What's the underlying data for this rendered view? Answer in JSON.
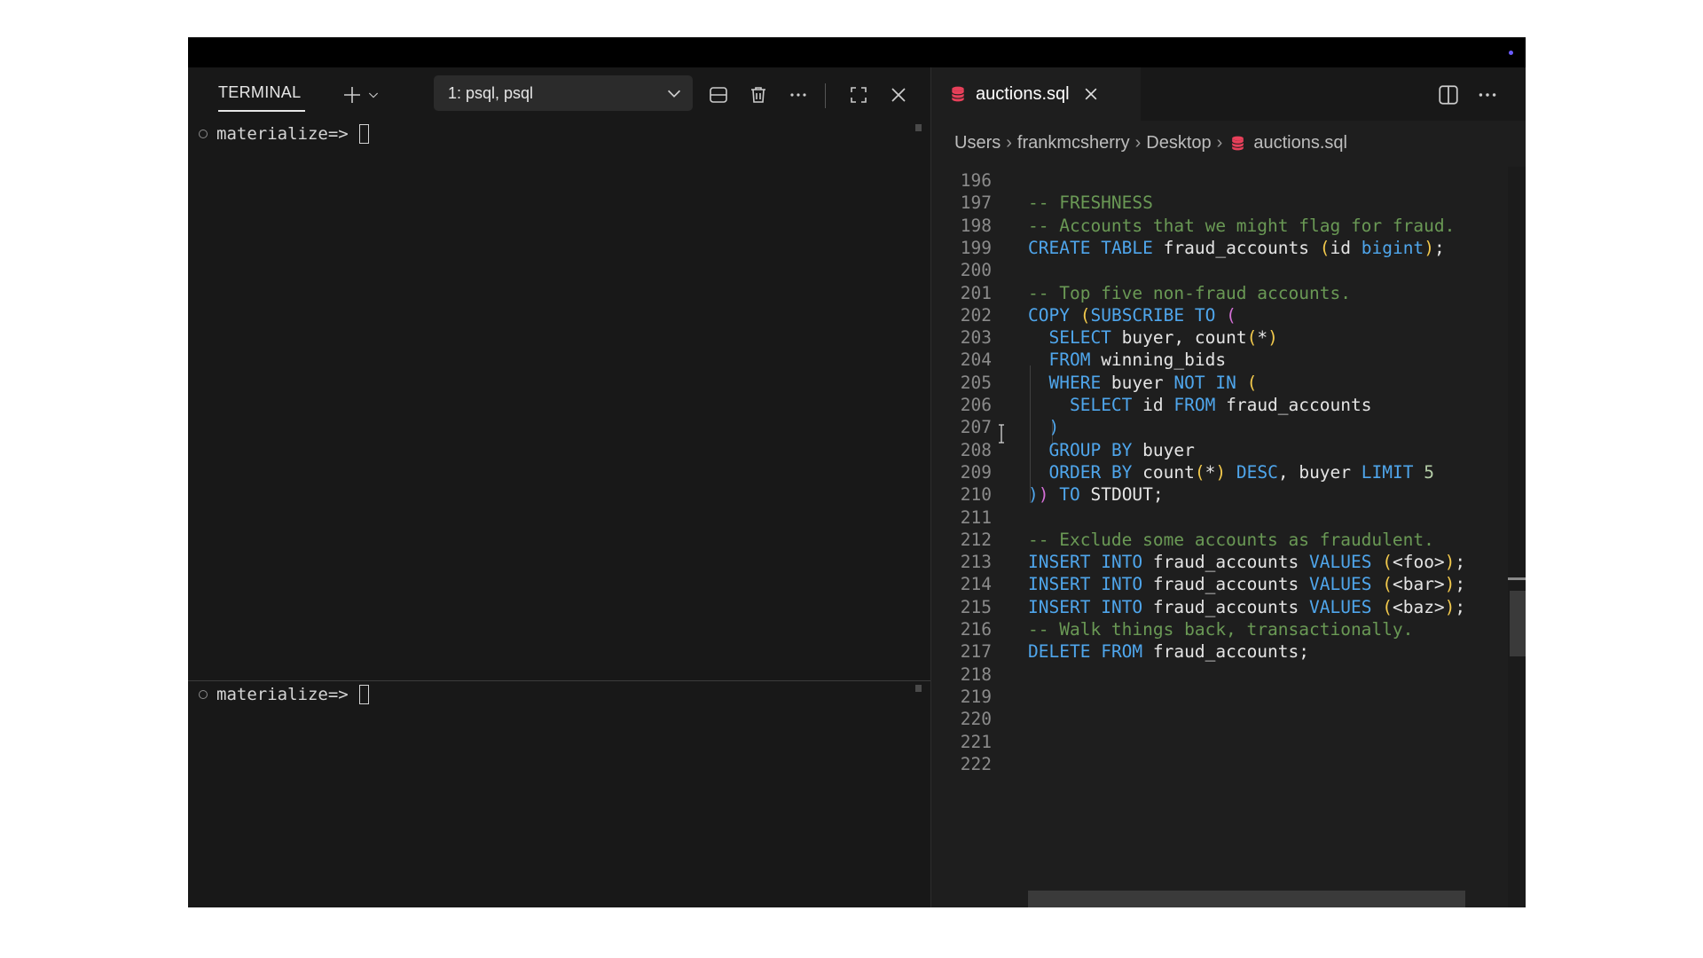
{
  "terminal": {
    "tab_label": "TERMINAL",
    "session_selected": "1: psql, psql",
    "icons": [
      "plus-icon",
      "chevron-down-icon",
      "split-pane-icon",
      "trash-icon",
      "ellipsis-icon",
      "maximize-icon",
      "close-icon"
    ],
    "panes": [
      {
        "prompt": "materialize=>"
      },
      {
        "prompt": "materialize=>"
      }
    ]
  },
  "editor": {
    "tab": {
      "label": "auctions.sql",
      "icon": "database-icon"
    },
    "breadcrumb": [
      "Users",
      "frankmcsherry",
      "Desktop",
      "auctions.sql"
    ],
    "lines": [
      {
        "n": "196",
        "t": ""
      },
      {
        "n": "197",
        "t": "-- FRESHNESS"
      },
      {
        "n": "198",
        "t": "-- Accounts that we might flag for fraud."
      },
      {
        "n": "199",
        "t": "CREATE TABLE fraud_accounts (id bigint);"
      },
      {
        "n": "200",
        "t": ""
      },
      {
        "n": "201",
        "t": "-- Top five non-fraud accounts."
      },
      {
        "n": "202",
        "t": "COPY (SUBSCRIBE TO ("
      },
      {
        "n": "203",
        "t": "  SELECT buyer, count(*)"
      },
      {
        "n": "204",
        "t": "  FROM winning_bids"
      },
      {
        "n": "205",
        "t": "  WHERE buyer NOT IN ("
      },
      {
        "n": "206",
        "t": "    SELECT id FROM fraud_accounts"
      },
      {
        "n": "207",
        "t": "  )"
      },
      {
        "n": "208",
        "t": "  GROUP BY buyer"
      },
      {
        "n": "209",
        "t": "  ORDER BY count(*) DESC, buyer LIMIT 5"
      },
      {
        "n": "210",
        "t": ")) TO STDOUT;"
      },
      {
        "n": "211",
        "t": ""
      },
      {
        "n": "212",
        "t": "-- Exclude some accounts as fraudulent."
      },
      {
        "n": "213",
        "t": "INSERT INTO fraud_accounts VALUES (<foo>);"
      },
      {
        "n": "214",
        "t": "INSERT INTO fraud_accounts VALUES (<bar>);"
      },
      {
        "n": "215",
        "t": "INSERT INTO fraud_accounts VALUES (<baz>);"
      },
      {
        "n": "216",
        "t": "-- Walk things back, transactionally."
      },
      {
        "n": "217",
        "t": "DELETE FROM fraud_accounts;"
      },
      {
        "n": "218",
        "t": ""
      },
      {
        "n": "219",
        "t": ""
      },
      {
        "n": "220",
        "t": ""
      },
      {
        "n": "221",
        "t": ""
      },
      {
        "n": "222",
        "t": ""
      }
    ]
  },
  "colors": {
    "keyword": "#4fa6ec",
    "comment": "#6a9955",
    "bracket_1": "#f2c94c",
    "bracket_2": "#d46fd6",
    "sql_file_icon": "#e8405a"
  }
}
